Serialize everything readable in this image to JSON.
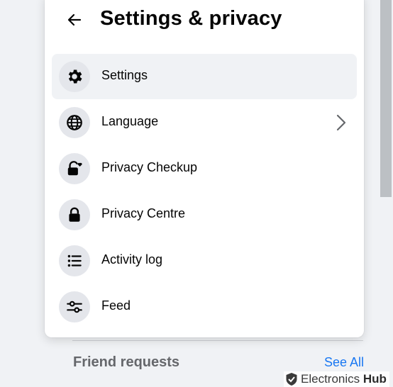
{
  "panel": {
    "title": "Settings & privacy",
    "back_icon": "back-arrow-icon",
    "items": [
      {
        "label": "Settings",
        "icon": "gear-icon",
        "active": true,
        "has_chevron": false
      },
      {
        "label": "Language",
        "icon": "globe-icon",
        "active": false,
        "has_chevron": true
      },
      {
        "label": "Privacy Checkup",
        "icon": "lock-heart-icon",
        "active": false,
        "has_chevron": false
      },
      {
        "label": "Privacy Centre",
        "icon": "lock-icon",
        "active": false,
        "has_chevron": false
      },
      {
        "label": "Activity log",
        "icon": "list-icon",
        "active": false,
        "has_chevron": false
      },
      {
        "label": "Feed",
        "icon": "sliders-icon",
        "active": false,
        "has_chevron": false
      }
    ]
  },
  "background": {
    "section_title": "Friend requests",
    "see_all": "See All"
  },
  "watermark": {
    "brand_regular": "Electronics",
    "brand_bold": "Hub"
  },
  "colors": {
    "page_bg": "#f0f2f5",
    "panel_bg": "#ffffff",
    "icon_circle": "#e4e6eb",
    "active_row": "#f0f2f5",
    "link": "#1877f2",
    "muted_text": "#65676b",
    "primary_text": "#050505"
  }
}
